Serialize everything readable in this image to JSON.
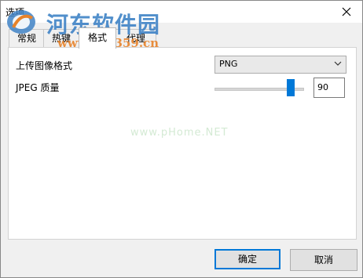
{
  "window": {
    "title": "选项"
  },
  "watermark": {
    "site_name": "河东软件园",
    "url": "www.pc0359.cn",
    "faint_text": "www.pHome.NET"
  },
  "tabs": [
    {
      "label": "常规"
    },
    {
      "label": "热键"
    },
    {
      "label": "格式"
    },
    {
      "label": "代理"
    }
  ],
  "active_tab": 2,
  "format": {
    "upload_format_label": "上传图像格式",
    "upload_format_value": "PNG",
    "jpeg_quality_label": "JPEG 质量",
    "jpeg_quality_value": "90",
    "jpeg_quality": 90
  },
  "buttons": {
    "ok": "确定",
    "cancel": "取消"
  },
  "colors": {
    "accent": "#0078d7",
    "watermark_blue": "#3f83c6",
    "watermark_orange": "#e8832a"
  },
  "icons": {
    "close": "close-icon",
    "dropdown": "chevron-down-icon",
    "logo": "pc0359-logo-icon"
  }
}
